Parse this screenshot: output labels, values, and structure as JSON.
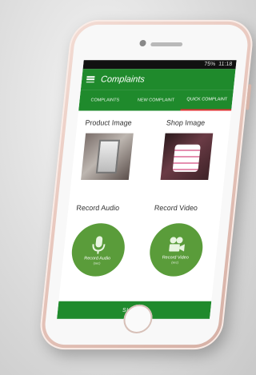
{
  "statusbar": {
    "battery": "75%",
    "time": "11:18"
  },
  "appbar": {
    "title": "Complaints",
    "menu_icon": "hamburger-menu-icon"
  },
  "tabs": [
    {
      "label": "COMPLAINTS"
    },
    {
      "label": "NEW COMPLAINT"
    },
    {
      "label": "QUICK COMPLAINT",
      "active": true
    }
  ],
  "main": {
    "product_image_label": "Product Image",
    "shop_image_label": "Shop Image",
    "record_audio_label": "Record Audio",
    "record_video_label": "Record Video",
    "audio_button": {
      "label": "Record Audio",
      "sub": "(sec)",
      "icon": "microphone-icon"
    },
    "video_button": {
      "label": "Record Video",
      "sub": "(sec)",
      "icon": "video-camera-icon"
    }
  },
  "submit_label": "SUBMIT",
  "colors": {
    "primary": "#1f8a2c",
    "accent": "#5a9c3a",
    "phone_frame": "#e8c7bd"
  }
}
